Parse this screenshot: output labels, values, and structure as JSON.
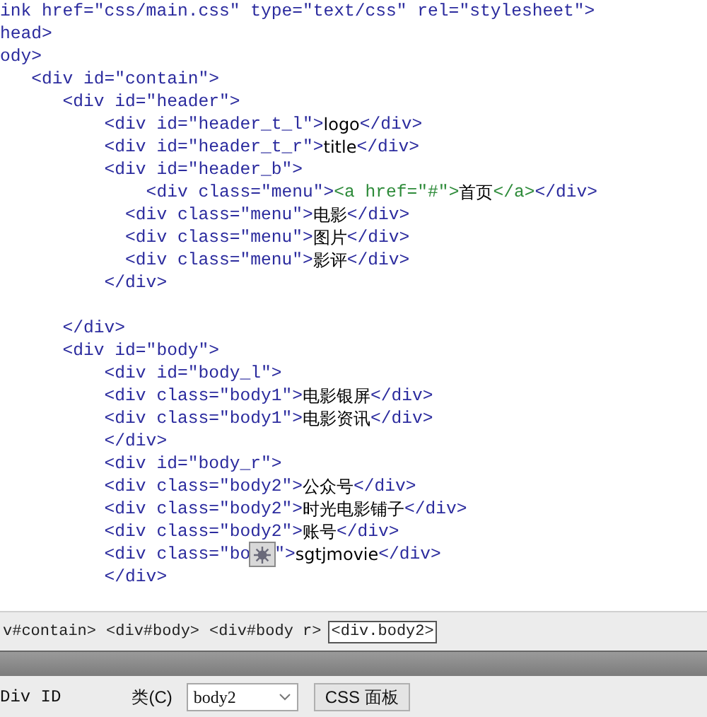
{
  "code_lines": [
    {
      "segments": [
        {
          "kind": "tag",
          "text": "ink href=\"css/main.css\" type=\"text/css\" rel=\"stylesheet\">"
        }
      ]
    },
    {
      "segments": [
        {
          "kind": "tag",
          "text": "head>"
        }
      ]
    },
    {
      "segments": [
        {
          "kind": "tag",
          "text": "ody>"
        }
      ]
    },
    {
      "segments": [
        {
          "kind": "tag",
          "text": "   <div id=\"contain\">"
        }
      ]
    },
    {
      "segments": [
        {
          "kind": "tag",
          "text": "      <div id=\"header\">"
        }
      ]
    },
    {
      "segments": [
        {
          "kind": "tag",
          "text": "          <div id=\"header_t_l\">"
        },
        {
          "kind": "text",
          "text": "logo"
        },
        {
          "kind": "tag",
          "text": "</div>"
        }
      ]
    },
    {
      "segments": [
        {
          "kind": "tag",
          "text": "          <div id=\"header_t_r\">"
        },
        {
          "kind": "text",
          "text": "title"
        },
        {
          "kind": "tag",
          "text": "</div>"
        }
      ]
    },
    {
      "segments": [
        {
          "kind": "tag",
          "text": "          <div id=\"header_b\">"
        }
      ]
    },
    {
      "segments": [
        {
          "kind": "tag",
          "text": "              <div class=\"menu\">"
        },
        {
          "kind": "anchor",
          "text": "<a href=\"#\">"
        },
        {
          "kind": "text",
          "text": "首页"
        },
        {
          "kind": "anchor",
          "text": "</a>"
        },
        {
          "kind": "tag",
          "text": "</div>"
        }
      ]
    },
    {
      "segments": [
        {
          "kind": "tag",
          "text": "            <div class=\"menu\">"
        },
        {
          "kind": "text",
          "text": "电影"
        },
        {
          "kind": "tag",
          "text": "</div>"
        }
      ]
    },
    {
      "segments": [
        {
          "kind": "tag",
          "text": "            <div class=\"menu\">"
        },
        {
          "kind": "text",
          "text": "图片"
        },
        {
          "kind": "tag",
          "text": "</div>"
        }
      ]
    },
    {
      "segments": [
        {
          "kind": "tag",
          "text": "            <div class=\"menu\">"
        },
        {
          "kind": "text",
          "text": "影评"
        },
        {
          "kind": "tag",
          "text": "</div>"
        }
      ]
    },
    {
      "segments": [
        {
          "kind": "tag",
          "text": "          </div>"
        }
      ],
      "blank_line_after": true
    },
    {
      "segments": [
        {
          "kind": "tag",
          "text": "      </div>"
        }
      ]
    },
    {
      "segments": [
        {
          "kind": "tag",
          "text": "      <div id=\"body\">"
        }
      ]
    },
    {
      "segments": [
        {
          "kind": "tag",
          "text": "          <div id=\"body_l\">"
        }
      ]
    },
    {
      "segments": [
        {
          "kind": "tag",
          "text": "          <div class=\"body1\">"
        },
        {
          "kind": "text",
          "text": "电影银屏"
        },
        {
          "kind": "tag",
          "text": "</div>"
        }
      ]
    },
    {
      "segments": [
        {
          "kind": "tag",
          "text": "          <div class=\"body1\">"
        },
        {
          "kind": "text",
          "text": "电影资讯"
        },
        {
          "kind": "tag",
          "text": "</div>"
        }
      ]
    },
    {
      "segments": [
        {
          "kind": "tag",
          "text": "          </div>"
        }
      ]
    },
    {
      "segments": [
        {
          "kind": "tag",
          "text": "          <div id=\"body_r\">"
        }
      ]
    },
    {
      "segments": [
        {
          "kind": "tag",
          "text": "          <div class=\"body2\">"
        },
        {
          "kind": "text",
          "text": "公众号"
        },
        {
          "kind": "tag",
          "text": "</div>"
        }
      ]
    },
    {
      "segments": [
        {
          "kind": "tag",
          "text": "          <div class=\"body2\">"
        },
        {
          "kind": "text",
          "text": "时光电影铺子"
        },
        {
          "kind": "tag",
          "text": "</div>"
        }
      ]
    },
    {
      "segments": [
        {
          "kind": "tag",
          "text": "          <div class=\"body2\">"
        },
        {
          "kind": "text",
          "text": "账号"
        },
        {
          "kind": "tag",
          "text": "</div>"
        }
      ]
    },
    {
      "segments": [
        {
          "kind": "tag",
          "text": "          <div class=\"bo"
        },
        {
          "kind": "marker"
        },
        {
          "kind": "tag",
          "text": "\">"
        },
        {
          "kind": "text",
          "text": "sgtjmovie"
        },
        {
          "kind": "tag",
          "text": "</div>"
        }
      ]
    },
    {
      "segments": [
        {
          "kind": "tag",
          "text": "          </div>"
        }
      ]
    }
  ],
  "tag_selector": [
    {
      "label": "v#contain>",
      "selected": false
    },
    {
      "label": "<div#body>",
      "selected": false
    },
    {
      "label": "<div#body r>",
      "selected": false
    },
    {
      "label": "<div.body2>",
      "selected": true
    }
  ],
  "properties": {
    "div_id_label": "Div ID",
    "class_label": "类(C)",
    "class_value": "body2",
    "css_button": "CSS 面板"
  }
}
